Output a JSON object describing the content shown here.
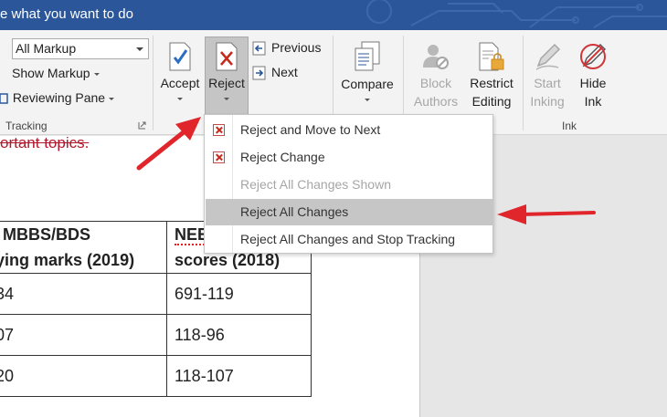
{
  "titlebar": {
    "tell_me": "e what you want to do"
  },
  "tracking": {
    "markup_select": "All Markup",
    "show_markup": "Show Markup",
    "reviewing_pane": "Reviewing Pane",
    "group_label": "Tracking"
  },
  "changes": {
    "accept": "Accept",
    "reject": "Reject",
    "previous": "Previous",
    "next": "Next"
  },
  "compare": {
    "label": "Compare"
  },
  "protect": {
    "block_authors_1": "Block",
    "block_authors_2": "Authors",
    "restrict_editing_1": "Restrict",
    "restrict_editing_2": "Editing"
  },
  "ink": {
    "start_inking_1": "Start",
    "start_inking_2": "Inking",
    "hide_ink_1": "Hide",
    "hide_ink_2": "Ink",
    "group_label": "Ink"
  },
  "reject_menu": {
    "items": [
      {
        "label": "Reject and Move to Next",
        "enabled": true,
        "icon": "reject-icon"
      },
      {
        "label": "Reject Change",
        "enabled": true,
        "icon": "reject-icon"
      },
      {
        "label": "Reject All Changes Shown",
        "enabled": false
      },
      {
        "label": "Reject All Changes",
        "enabled": true,
        "highlighted": true
      },
      {
        "label": "Reject All Changes and Stop Tracking",
        "enabled": true
      }
    ]
  },
  "document": {
    "deleted_text": "ortant topics.",
    "table": {
      "header": [
        "MBBS/BDS",
        "ying marks (2019)",
        "NEE",
        "scores (2018)"
      ],
      "rows": [
        [
          "34",
          "691-119"
        ],
        [
          "07",
          "118-96"
        ],
        [
          "20",
          "118-107"
        ]
      ]
    }
  },
  "colors": {
    "title_bar": "#2b579a",
    "deleted_text": "#b3192e",
    "arrow": "#e0252b"
  }
}
